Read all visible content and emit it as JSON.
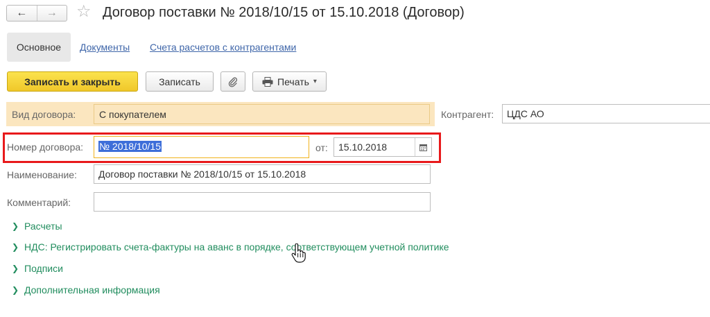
{
  "window": {
    "title": "Договор поставки № 2018/10/15 от 15.10.2018 (Договор)",
    "back_icon": "←",
    "forward_icon": "→",
    "star_icon": "☆"
  },
  "tabs": [
    {
      "label": "Основное",
      "active": true
    },
    {
      "label": "Документы",
      "active": false
    },
    {
      "label": "Счета расчетов с контрагентами",
      "active": false
    }
  ],
  "toolbar": {
    "save_close_label": "Записать и закрыть",
    "save_label": "Записать",
    "attach_icon": "paperclip-icon",
    "print_label": "Печать",
    "print_icon": "printer-icon",
    "print_arrow": "▾"
  },
  "form": {
    "type_label": "Вид договора:",
    "type_value": "С покупателем",
    "counterparty_label": "Контрагент:",
    "counterparty_value": "ЦДС АО",
    "number_label": "Номер договора:",
    "number_value": "№ 2018/10/15",
    "date_label": "от:",
    "date_value": "15.10.2018",
    "name_label": "Наименование:",
    "name_value": "Договор поставки № 2018/10/15 от 15.10.2018",
    "comment_label": "Комментарий:",
    "comment_value": ""
  },
  "groups": [
    {
      "label": "Расчеты"
    },
    {
      "label": "НДС: Регистрировать счета-фактуры на аванс в порядке, соответствующем учетной политике"
    },
    {
      "label": "Подписи"
    },
    {
      "label": "Дополнительная информация"
    }
  ],
  "colors": {
    "primary_button": "#f5d33a",
    "highlight_border": "#e8191b",
    "group_link": "#218d5e",
    "tab_link": "#3f66a9",
    "selection": "#3d6ed9"
  }
}
